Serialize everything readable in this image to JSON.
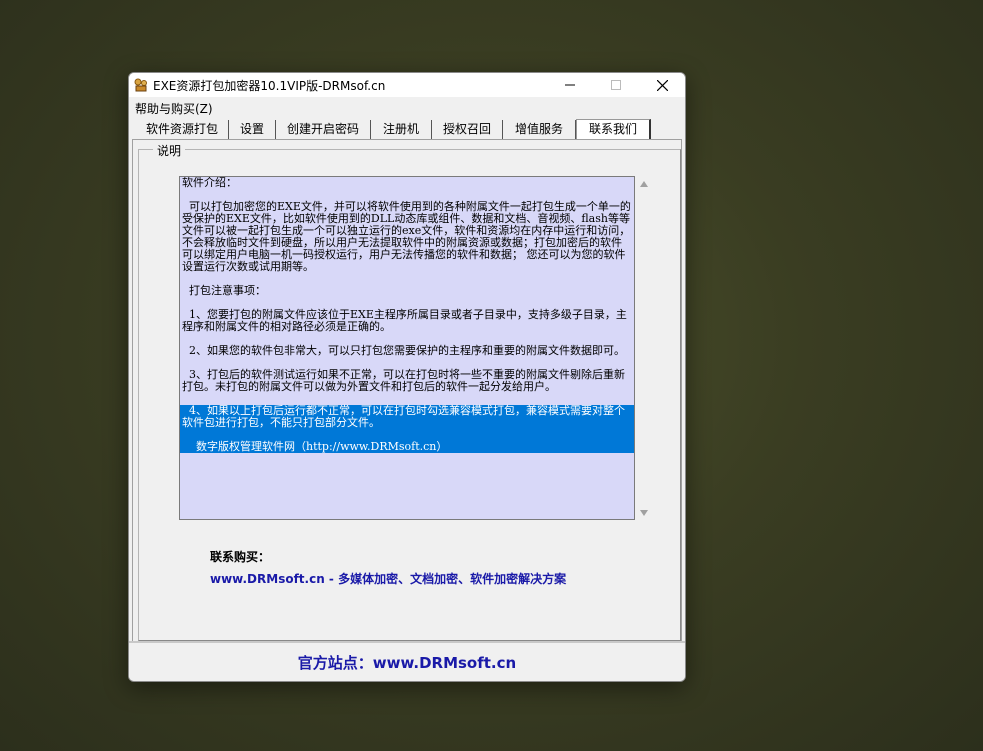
{
  "window": {
    "title": "EXE资源打包加密器10.1VIP版-DRMsof.cn",
    "app_icon": "app-icon"
  },
  "menu": {
    "items": [
      {
        "label": "帮助与购买(Z)"
      }
    ]
  },
  "tabs": [
    {
      "label": "软件资源打包",
      "active": false
    },
    {
      "label": "设置",
      "active": false
    },
    {
      "label": "创建开启密码",
      "active": false
    },
    {
      "label": "注册机",
      "active": false
    },
    {
      "label": "授权召回",
      "active": false
    },
    {
      "label": "增值服务",
      "active": false
    },
    {
      "label": "联系我们",
      "active": true
    }
  ],
  "panel": {
    "group_label": "说明",
    "memo": {
      "heading": "软件介绍：",
      "intro": "  可以打包加密您的EXE文件，并可以将软件使用到的各种附属文件一起打包生成一个单一的受保护的EXE文件，比如软件使用到的DLL动态库或组件、数据和文档、音视频、flash等等文件可以被一起打包生成一个可以独立运行的exe文件，软件和资源均在内存中运行和访问，不会释放临时文件到硬盘，所以用户无法提取软件中的附属资源或数据；打包加密后的软件可以绑定用户电脑一机一码授权运行，用户无法传播您的软件和数据； 您还可以为您的软件设置运行次数或试用期等。",
      "notes_heading": "  打包注意事项：",
      "note1": "  1、您要打包的附属文件应该位于EXE主程序所属目录或者子目录中，支持多级子目录，主程序和附属文件的相对路径必须是正确的。",
      "note2": "  2、如果您的软件包非常大，可以只打包您需要保护的主程序和重要的附属文件数据即可。",
      "note3": "  3、打包后的软件测试运行如果不正常，可以在打包时将一些不重要的附属文件剔除后重新打包。未打包的附属文件可以做为外置文件和打包后的软件一起分发给用户。",
      "note4": "  4、如果以上打包后运行都不正常，可以在打包时勾选兼容模式打包，兼容模式需要对整个软件包进行打包，不能只打包部分文件。",
      "footer_line": "    数字版权管理软件网（http://www.DRMsoft.cn）"
    },
    "contact_label": "联系购买：",
    "contact_link": "www.DRMsoft.cn - 多媒体加密、文档加密、软件加密解决方案"
  },
  "footer": {
    "site_text": "官方站点：www.DRMsoft.cn"
  },
  "colors": {
    "memo_bg": "#d8d8f8",
    "selection": "#0078d7",
    "link_blue": "#1a1aa8"
  }
}
